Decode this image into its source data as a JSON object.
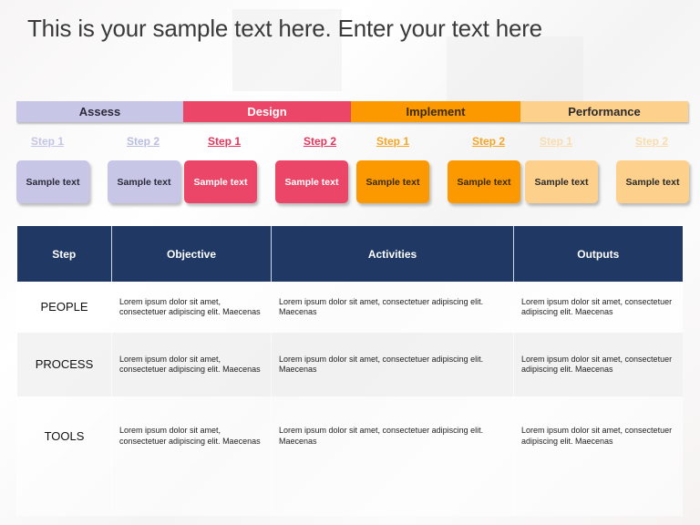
{
  "title": "This is your sample text here. Enter your text here",
  "phases": [
    {
      "label": "Assess",
      "color": "#c7c6e6",
      "text_color": "#2a2a3a",
      "steps": [
        {
          "label": "Step 1",
          "color": "#c3c5e8"
        },
        {
          "label": "Step 2",
          "color": "#b9bde0"
        }
      ],
      "cards": [
        {
          "text": "Sample text"
        },
        {
          "text": "Sample text"
        }
      ]
    },
    {
      "label": "Design",
      "color": "#eb4668",
      "text_color": "#ffffff",
      "steps": [
        {
          "label": "Step 1",
          "color": "#e0355c"
        },
        {
          "label": "Step 2",
          "color": "#e0355c"
        }
      ],
      "cards": [
        {
          "text": "Sample text"
        },
        {
          "text": "Sample text"
        }
      ]
    },
    {
      "label": "Implement",
      "color": "#fc9900",
      "text_color": "#3a2a10",
      "steps": [
        {
          "label": "Step 1",
          "color": "#f4a526"
        },
        {
          "label": "Step 2",
          "color": "#f4a526"
        }
      ],
      "cards": [
        {
          "text": "Sample text"
        },
        {
          "text": "Sample text"
        }
      ]
    },
    {
      "label": "Performance",
      "color": "#fdd08c",
      "text_color": "#2a2a2a",
      "steps": [
        {
          "label": "Step 1",
          "color": "#f8dcae"
        },
        {
          "label": "Step 2",
          "color": "#f8dcae"
        }
      ],
      "cards": [
        {
          "text": "Sample text"
        },
        {
          "text": "Sample text"
        }
      ]
    }
  ],
  "table": {
    "header_color": "#1f3864",
    "columns": [
      "Step",
      "Objective",
      "Activities",
      "Outputs"
    ],
    "rows": [
      {
        "step": "PEOPLE",
        "objective": "Lorem ipsum dolor sit amet, consectetuer adipiscing elit. Maecenas",
        "activities": "Lorem ipsum dolor sit amet, consectetuer adipiscing elit. Maecenas",
        "outputs": "Lorem ipsum dolor sit amet, consectetuer adipiscing elit. Maecenas"
      },
      {
        "step": "PROCESS",
        "objective": "Lorem ipsum dolor sit amet, consectetuer adipiscing elit. Maecenas",
        "activities": "Lorem ipsum dolor sit amet, consectetuer adipiscing elit. Maecenas",
        "outputs": "Lorem ipsum dolor sit amet, consectetuer adipiscing elit. Maecenas"
      },
      {
        "step": "TOOLS",
        "objective": "Lorem ipsum dolor sit amet, consectetuer adipiscing elit. Maecenas",
        "activities": "Lorem ipsum dolor sit amet, consectetuer adipiscing elit. Maecenas",
        "outputs": "Lorem ipsum dolor sit amet, consectetuer adipiscing elit. Maecenas"
      }
    ]
  }
}
